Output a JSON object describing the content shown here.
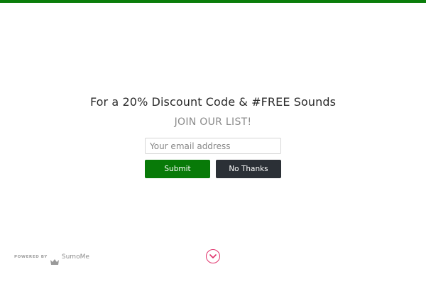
{
  "popup": {
    "headline": "For a 20% Discount Code & #FREE Sounds",
    "subheadline": "JOIN OUR LIST!",
    "email_placeholder": "Your email address",
    "submit_label": "Submit",
    "decline_label": "No Thanks"
  },
  "footer": {
    "powered_by": "POWERED BY",
    "brand": "SumoMe",
    "brand_icon": "crown-icon",
    "scroll_icon": "chevron-down-icon"
  },
  "colors": {
    "accent_green": "#0a7d0a",
    "dark_button": "#2b3036",
    "scroll_accent": "#e0316b"
  }
}
